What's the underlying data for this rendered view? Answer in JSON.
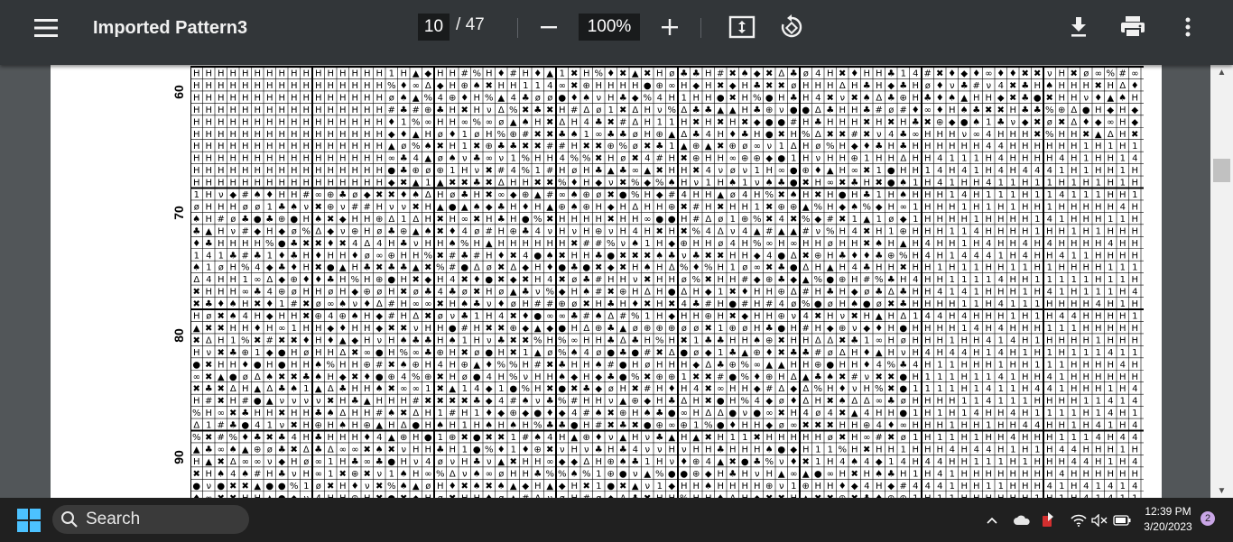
{
  "toolbar": {
    "document_title": "Imported Pattern3",
    "current_page": "10",
    "page_separator": "/",
    "total_pages": "47",
    "zoom_level": "100%",
    "icons": [
      "menu-icon",
      "zoom-out-icon",
      "zoom-in-icon",
      "fit-to-page-icon",
      "rotate-icon",
      "download-icon",
      "print-icon",
      "more-options-icon"
    ]
  },
  "document": {
    "row_labels": [
      "60",
      "70",
      "80",
      "90"
    ]
  },
  "taskbar": {
    "search_label": "Search",
    "time": "12:39 PM",
    "date": "3/20/2023",
    "notification_count": "2",
    "icons": [
      "windows-start-icon",
      "search-icon",
      "chevron-up-icon",
      "onedrive-cloud-icon",
      "tray-app-icon",
      "wifi-icon",
      "speaker-muted-icon",
      "battery-icon"
    ]
  },
  "colors": {
    "toolbar_bg": "#323639",
    "viewer_bg": "#525659",
    "page_bg": "#ffffff",
    "taskbar_bg": "#202020",
    "notification_badge": "#c9a6e6"
  }
}
